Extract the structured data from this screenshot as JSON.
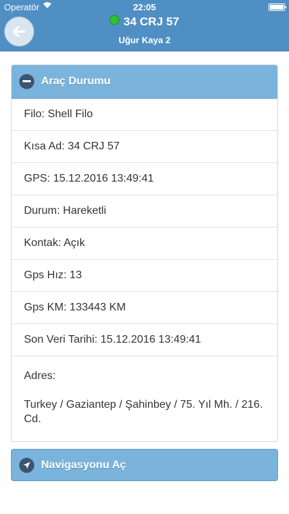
{
  "statusbar": {
    "carrier": "Operatör",
    "time": "22:05"
  },
  "header": {
    "plate": "34 CRJ 57",
    "driver": "Uğur Kaya 2"
  },
  "panel": {
    "title": "Araç Durumu",
    "rows": [
      "Filo: Shell Filo",
      "Kısa Ad: 34 CRJ 57",
      "GPS: 15.12.2016 13:49:41",
      "Durum: Hareketli",
      "Kontak: Açık",
      "Gps Hız: 13",
      "Gps KM: 133443 KM",
      "Son Veri Tarihi: 15.12.2016 13:49:41"
    ],
    "address_label": "Adres:",
    "address_value": "Turkey / Gaziantep / Şahinbey / 75. Yıl Mh. / 216. Cd."
  },
  "nav": {
    "label": "Navigasyonu Aç"
  },
  "colors": {
    "header": "#4f8fc4",
    "accent": "#7ab4dd",
    "online": "#2fc32f"
  }
}
